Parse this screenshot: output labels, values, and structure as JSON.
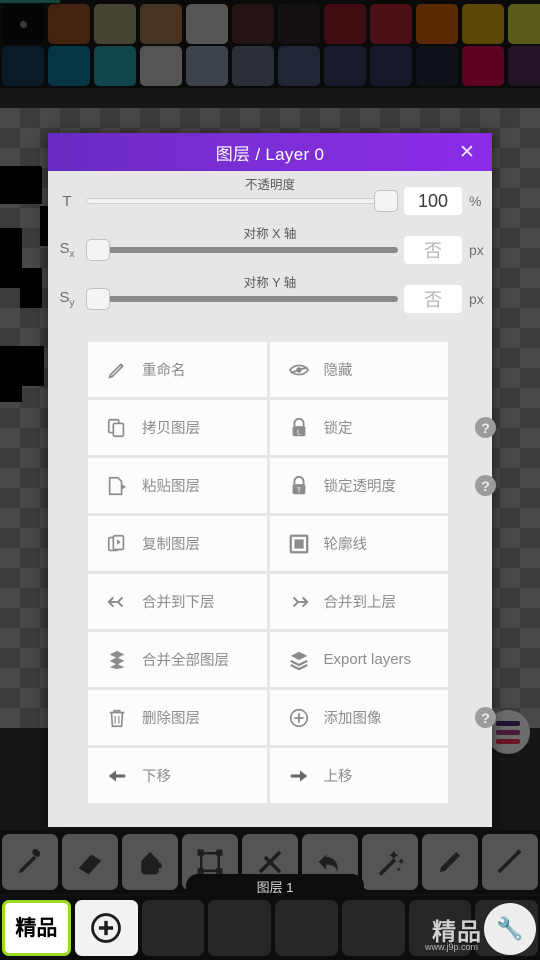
{
  "palette": {
    "row1": [
      "#050505",
      "#43230f",
      "#474334",
      "#463322",
      "#555555",
      "#231312",
      "#151012",
      "#3f0d11",
      "#4d1016",
      "#5a2a07",
      "#5b4507",
      "#5a5a1c",
      "#1c4b19"
    ],
    "row2": [
      "#0b1a28",
      "#053444",
      "#10464a",
      "#555555",
      "#3d434a",
      "#2a2f38",
      "#212634",
      "#181c2a",
      "#14182a",
      "#0f1118",
      "#5c0320",
      "#251327",
      "#3d1a33"
    ],
    "current_index": 0
  },
  "dialog": {
    "title": "图层 / Layer 0",
    "close_label": "✕",
    "sliders": [
      {
        "caption": "不透明度",
        "label": "T",
        "sub": "",
        "value": "100",
        "unit": "%",
        "track": "light",
        "thumb_pct": 100,
        "placeholder": false
      },
      {
        "caption": "对称 X 轴",
        "label": "S",
        "sub": "x",
        "value": "否",
        "unit": "px",
        "track": "dark",
        "thumb_pct": 0,
        "placeholder": true
      },
      {
        "caption": "对称 Y 轴",
        "label": "S",
        "sub": "y",
        "value": "否",
        "unit": "px",
        "track": "dark",
        "thumb_pct": 0,
        "placeholder": true
      }
    ],
    "menu_rows": [
      {
        "left": {
          "label": "重命名",
          "icon": "pencil-icon"
        },
        "right": {
          "label": "隐藏",
          "icon": "eye-off-icon"
        },
        "help": false
      },
      {
        "left": {
          "label": "拷贝图层",
          "icon": "copy-icon"
        },
        "right": {
          "label": "锁定",
          "icon": "lock-icon"
        },
        "help": true
      },
      {
        "left": {
          "label": "粘贴图层",
          "icon": "paste-icon"
        },
        "right": {
          "label": "锁定透明度",
          "icon": "lock-alpha-icon"
        },
        "help": true
      },
      {
        "left": {
          "label": "复制图层",
          "icon": "duplicate-icon"
        },
        "right": {
          "label": "轮廓线",
          "icon": "outline-icon"
        },
        "help": false
      },
      {
        "left": {
          "label": "合并到下层",
          "icon": "merge-down-icon"
        },
        "right": {
          "label": "合并到上层",
          "icon": "merge-up-icon"
        },
        "help": false
      },
      {
        "left": {
          "label": "合并全部图层",
          "icon": "flatten-icon"
        },
        "right": {
          "label": "Export layers",
          "icon": "layers-icon"
        },
        "help": false
      },
      {
        "left": {
          "label": "删除图层",
          "icon": "trash-icon"
        },
        "right": {
          "label": "添加图像",
          "icon": "add-image-icon"
        },
        "help": true
      },
      {
        "left": {
          "label": "下移",
          "icon": "arrow-left-icon"
        },
        "right": {
          "label": "上移",
          "icon": "arrow-right-icon"
        },
        "help": false
      }
    ],
    "help_label": "?"
  },
  "toolbar": {
    "tools": [
      {
        "name": "eyedropper-icon"
      },
      {
        "name": "eraser-icon"
      },
      {
        "name": "fill-bucket-icon"
      },
      {
        "name": "transform-icon"
      },
      {
        "name": "tools-icon"
      },
      {
        "name": "undo-icon"
      },
      {
        "name": "magic-wand-icon"
      },
      {
        "name": "pencil-tool-icon"
      },
      {
        "name": "pen-tool-icon"
      }
    ]
  },
  "layerbar": {
    "tooltip": "图层 1",
    "thumbnail_text": "精品",
    "add_label": "+",
    "slots": 4
  },
  "watermark": {
    "text": "精品",
    "url": "www.j9p.com",
    "badge": "🔧"
  },
  "colors": {
    "accent_start": "#6a2ac3",
    "accent_end": "#8c2ce8",
    "dialog_bg": "#e6e6e6",
    "cell_bg": "#fcfcfc",
    "label_gray": "#8c8c8c",
    "selection_green": "#9ade1b"
  }
}
